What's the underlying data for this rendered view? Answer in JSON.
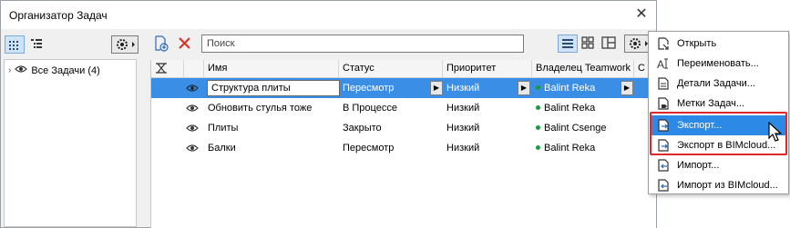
{
  "window": {
    "title": "Организатор Задач"
  },
  "tree": {
    "root_label": "Все Задачи (4)"
  },
  "search": {
    "placeholder": "Поиск"
  },
  "table": {
    "columns": [
      "Имя",
      "Статус",
      "Приоритет",
      "Владелец Teamwork",
      "С"
    ],
    "rows": [
      {
        "name": "Структура плиты",
        "status": "Пересмотр",
        "priority": "Низкий",
        "owner": "Balint Reka",
        "selected": true
      },
      {
        "name": "Обновить стулья тоже",
        "status": "В Процессе",
        "priority": "Низкий",
        "owner": "Balint Reka",
        "selected": false
      },
      {
        "name": "Плиты",
        "status": "Закрыто",
        "priority": "Низкий",
        "owner": "Balint Csenge",
        "selected": false
      },
      {
        "name": "Балки",
        "status": "Пересмотр",
        "priority": "Низкий",
        "owner": "Balint Reka",
        "selected": false
      }
    ]
  },
  "menu": {
    "items": [
      {
        "label": "Открыть",
        "icon": "open-icon"
      },
      {
        "label": "Переименовать...",
        "icon": "rename-icon"
      },
      {
        "label": "Детали Задачи...",
        "icon": "task-details-icon"
      },
      {
        "label": "Метки Задач...",
        "icon": "task-labels-icon"
      },
      {
        "label": "Экспорт...",
        "icon": "export-icon",
        "highlighted": true
      },
      {
        "label": "Экспорт в BIMcloud...",
        "icon": "export-bimcloud-icon"
      },
      {
        "label": "Импорт...",
        "icon": "import-icon"
      },
      {
        "label": "Импорт из BIMcloud...",
        "icon": "import-bimcloud-icon"
      }
    ]
  },
  "colors": {
    "selection": "#3a8ee6",
    "menu_highlight": "#2d89e6",
    "callout_frame": "#e0262b",
    "owner_dot": "#1a9b3f",
    "delete_x": "#d9342b"
  }
}
